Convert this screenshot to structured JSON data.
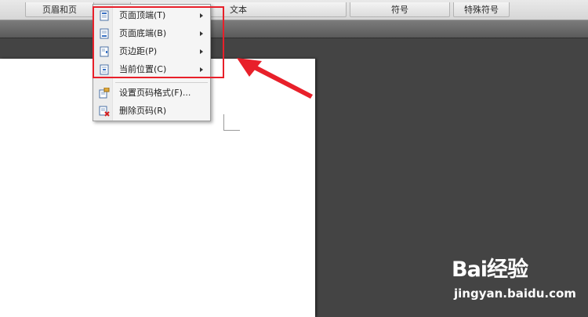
{
  "ribbon": {
    "groups": [
      {
        "label": "页眉和页"
      },
      {
        "label": "文本"
      },
      {
        "label": "符号"
      },
      {
        "label": "特殊符号"
      }
    ]
  },
  "menu": {
    "items": [
      {
        "label": "页面顶端(T)",
        "icon": "page-top-icon",
        "has_submenu": true
      },
      {
        "label": "页面底端(B)",
        "icon": "page-bottom-icon",
        "has_submenu": true
      },
      {
        "label": "页边距(P)",
        "icon": "page-margin-icon",
        "has_submenu": true
      },
      {
        "label": "当前位置(C)",
        "icon": "current-position-icon",
        "has_submenu": true
      },
      {
        "label": "设置页码格式(F)...",
        "icon": "format-page-number-icon",
        "has_submenu": false
      },
      {
        "label": "删除页码(R)",
        "icon": "delete-page-number-icon",
        "has_submenu": false
      }
    ]
  },
  "annotation": {
    "color": "#e8202a"
  },
  "watermark": {
    "logo": "Bai经验",
    "url": "jingyan.baidu.com"
  }
}
